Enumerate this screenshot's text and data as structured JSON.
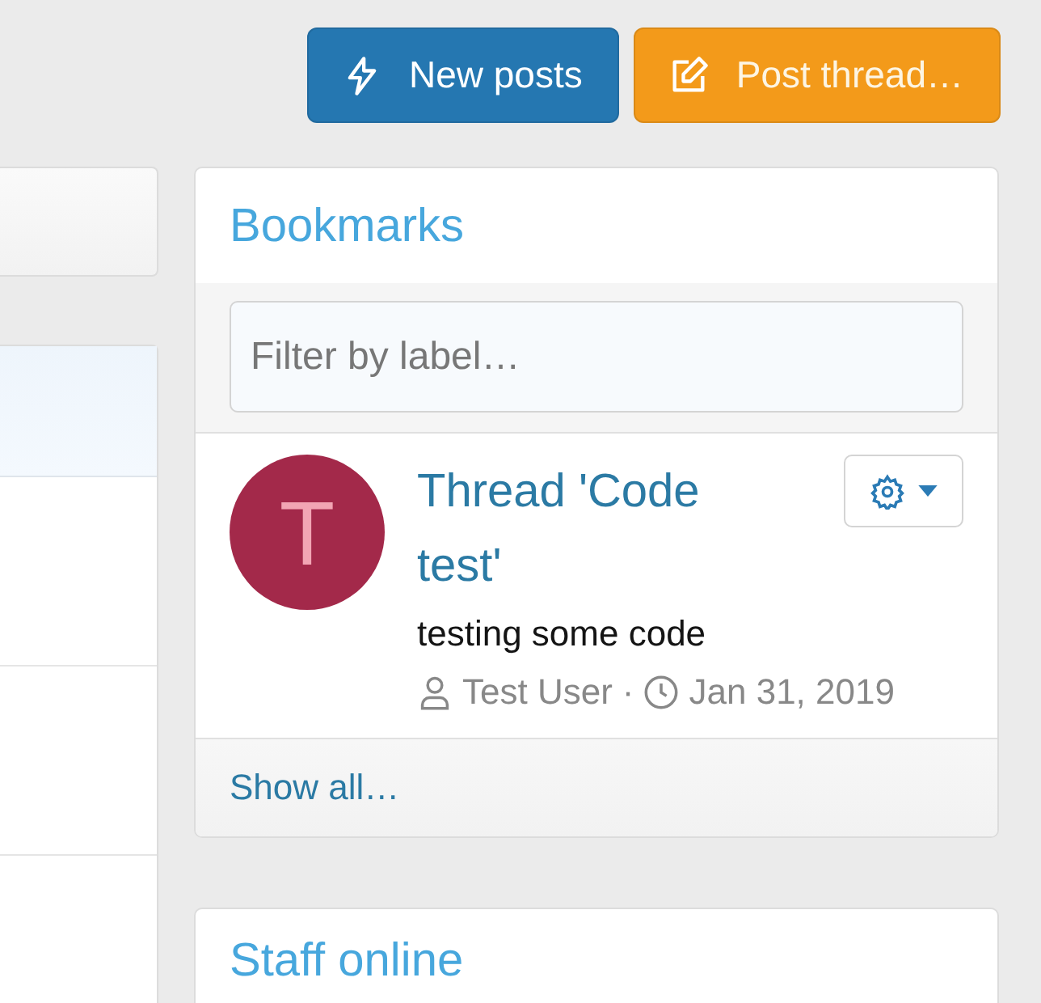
{
  "header_buttons": [
    {
      "label": "New posts",
      "kind": "new"
    },
    {
      "label": "Post thread…",
      "kind": "post"
    }
  ],
  "bookmarks": {
    "title": "Bookmarks",
    "filter": {
      "placeholder": "Filter by label…"
    },
    "items": [
      {
        "avatar_letter": "T",
        "color": "#a3294a",
        "title": "Thread 'Code test'",
        "snippet": "testing some code",
        "user": "Test User",
        "separator": "·",
        "date": "Jan 31, 2019"
      }
    ],
    "footer_link": "Show all…"
  },
  "staff_online": {
    "title": "Staff online"
  }
}
